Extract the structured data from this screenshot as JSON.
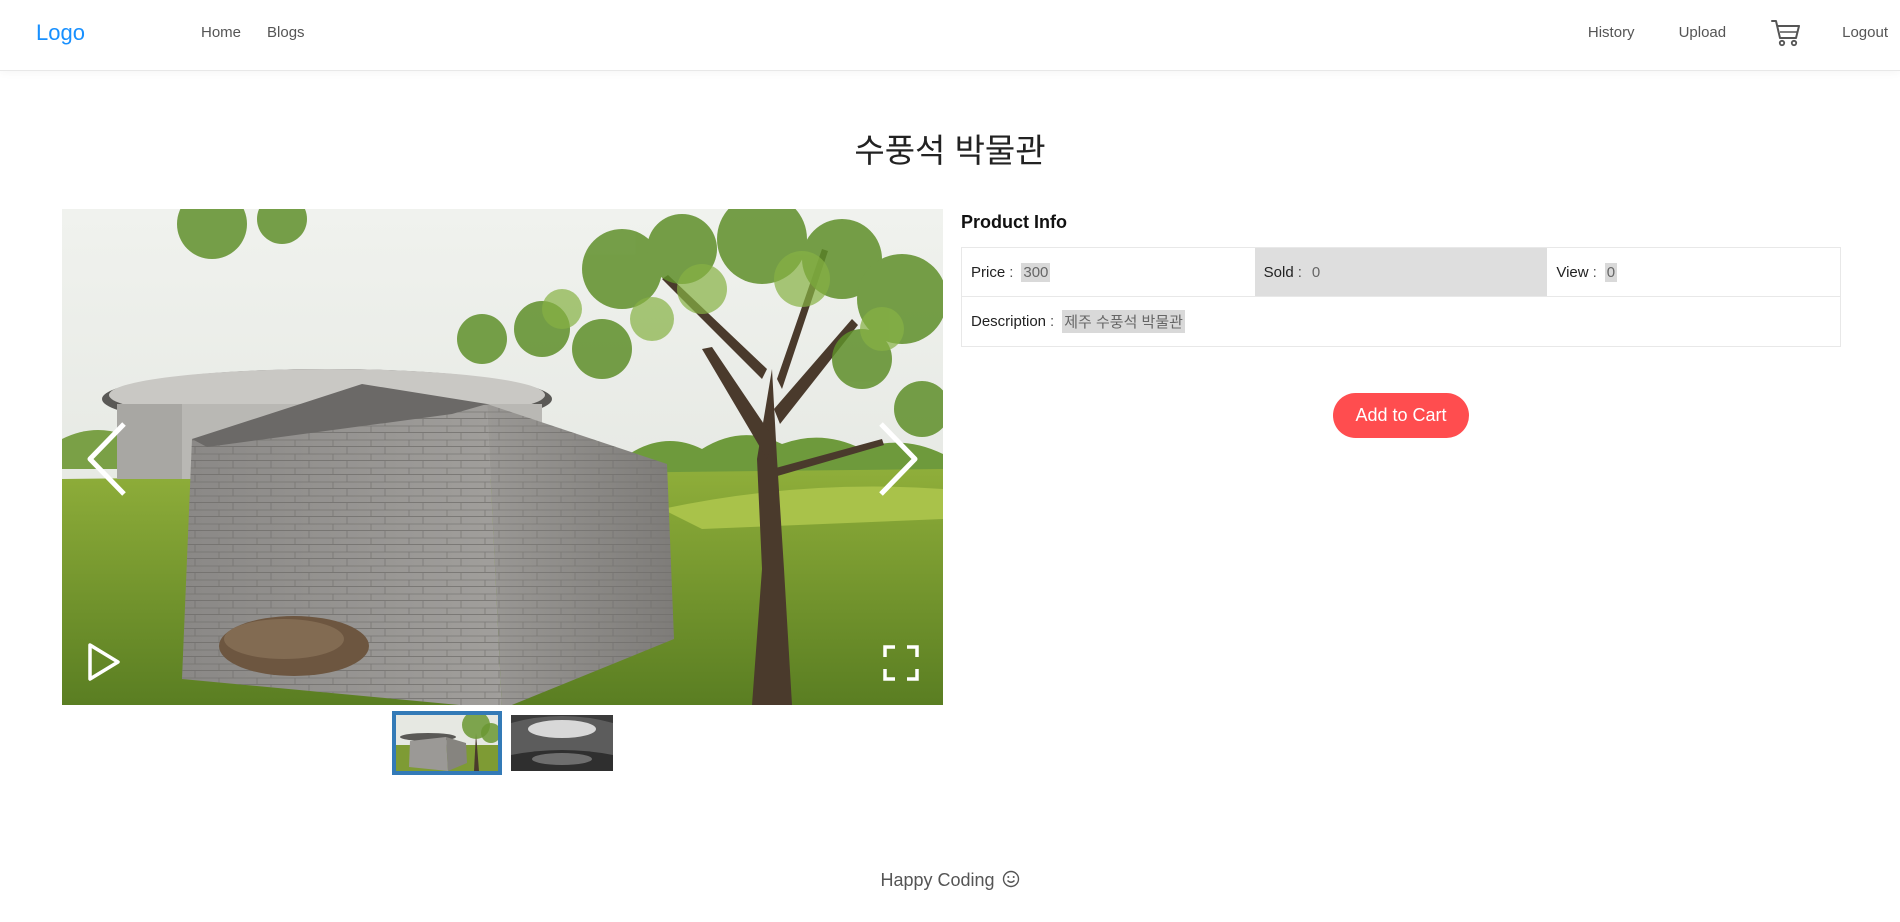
{
  "header": {
    "logo": "Logo",
    "nav_left": {
      "home": "Home",
      "blogs": "Blogs"
    },
    "nav_right": {
      "history": "History",
      "upload": "Upload",
      "logout": "Logout"
    },
    "cart_icon": "shopping-cart-icon"
  },
  "product": {
    "title": "수풍석 박물관",
    "info_title": "Product Info",
    "price_label": "Price",
    "price_value": "300",
    "sold_label": "Sold",
    "sold_value": "0",
    "view_label": "View",
    "view_value": "0",
    "description_label": "Description",
    "description_value": "제주 수풍석 박물관",
    "separator": ":",
    "add_to_cart": "Add to Cart"
  },
  "gallery": {
    "images": [
      "museum-exterior-photo",
      "museum-interior-photo"
    ],
    "selected_index": 0,
    "controls": [
      "left-arrow-icon",
      "right-arrow-icon",
      "play-icon",
      "fullscreen-icon"
    ]
  },
  "footer": {
    "text": "Happy Coding",
    "icon": "smile-icon"
  },
  "colors": {
    "logo": "#1890ff",
    "add_button": "#ff4d4f",
    "thumb_active_border": "#337ab7",
    "highlight": "#d9d9d9"
  }
}
